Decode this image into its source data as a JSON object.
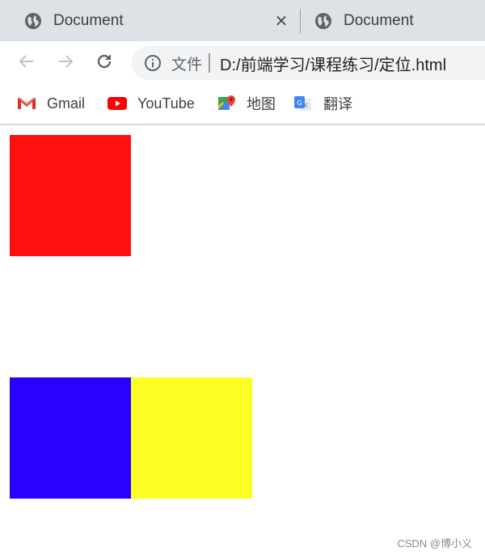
{
  "browser": {
    "tabs": [
      {
        "title": "Document",
        "icon": "globe-icon",
        "active": true
      },
      {
        "title": "Document",
        "icon": "globe-icon",
        "active": false
      }
    ],
    "tab_close_glyph": "×",
    "toolbar": {
      "back_icon": "arrow-left-icon",
      "forward_icon": "arrow-right-icon",
      "reload_icon": "reload-icon",
      "security_icon": "info-icon",
      "scheme_label": "文件",
      "url": "D:/前端学习/课程练习/定位.html"
    },
    "bookmarks": [
      {
        "label": "Gmail",
        "icon": "gmail-icon"
      },
      {
        "label": "YouTube",
        "icon": "youtube-icon"
      },
      {
        "label": "地图",
        "icon": "maps-icon"
      },
      {
        "label": "翻译",
        "icon": "translate-icon"
      }
    ]
  },
  "page": {
    "boxes": [
      {
        "name": "red-box",
        "color": "#ff1010"
      },
      {
        "name": "blue-box",
        "color": "#2a00ff"
      },
      {
        "name": "yellow-box",
        "color": "#fcff24"
      }
    ]
  },
  "watermark": "CSDN @博小义",
  "colors": {
    "tabstrip_bg": "#dee1e6",
    "omnibox_bg": "#f1f3f4"
  }
}
